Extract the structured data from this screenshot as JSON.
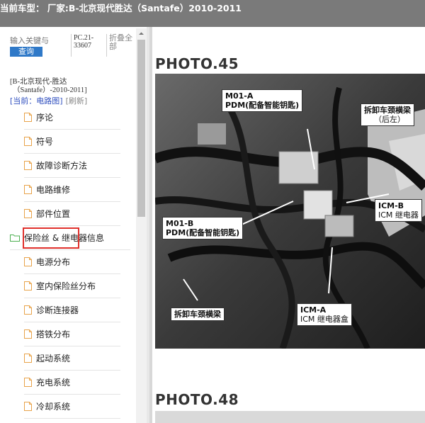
{
  "header": {
    "title": "当前车型：  厂家:B-北京现代胜达（Santafe）2010-2011"
  },
  "sidebar": {
    "search": {
      "placeholder": "输入关键与",
      "query_label": "查询"
    },
    "code_label": "PC.21-33607",
    "fold_label": "折叠全部",
    "vehicle_lines": [
      "[B-北京现代-胜达",
      "（Santafe）-2010-2011]"
    ],
    "current_label": "[当前：电路图]",
    "refresh_label": "[刷新]",
    "items": [
      {
        "label": "序论",
        "type": "doc"
      },
      {
        "label": "符号",
        "type": "doc"
      },
      {
        "label": "故障诊断方法",
        "type": "doc"
      },
      {
        "label": "电路维修",
        "type": "doc"
      },
      {
        "label": "部件位置",
        "type": "doc",
        "selected": true
      },
      {
        "label": "保险丝 & 继电器信息",
        "type": "folder"
      },
      {
        "label": "电源分布",
        "type": "doc"
      },
      {
        "label": "室内保险丝分布",
        "type": "doc"
      },
      {
        "label": "诊断连接器",
        "type": "doc"
      },
      {
        "label": "搭铁分布",
        "type": "doc"
      },
      {
        "label": "起动系统",
        "type": "doc"
      },
      {
        "label": "充电系统",
        "type": "doc"
      },
      {
        "label": "冷却系统",
        "type": "doc"
      }
    ]
  },
  "main": {
    "photo1": {
      "title": "PHOTO.45",
      "labels": {
        "m01a_code": "M01-A",
        "m01a_desc": "PDM(配备智能钥匙)",
        "remove_top": "拆卸车颈横梁",
        "remove_top_sub": "（后左）",
        "m01b_code": "M01-B",
        "m01b_desc": "PDM(配备智能钥匙)",
        "icmb_code": "ICM-B",
        "icmb_desc": "ICM 继电器",
        "remove_bottom": "拆卸车颈横梁",
        "icma_code": "ICM-A",
        "icma_desc": "ICM 继电器盒"
      }
    },
    "photo2": {
      "title": "PHOTO.48"
    }
  },
  "colors": {
    "topbar": "#7a7a7a",
    "accent": "#2f79c8",
    "highlight": "#e0302c",
    "link": "#2f4fbf"
  }
}
